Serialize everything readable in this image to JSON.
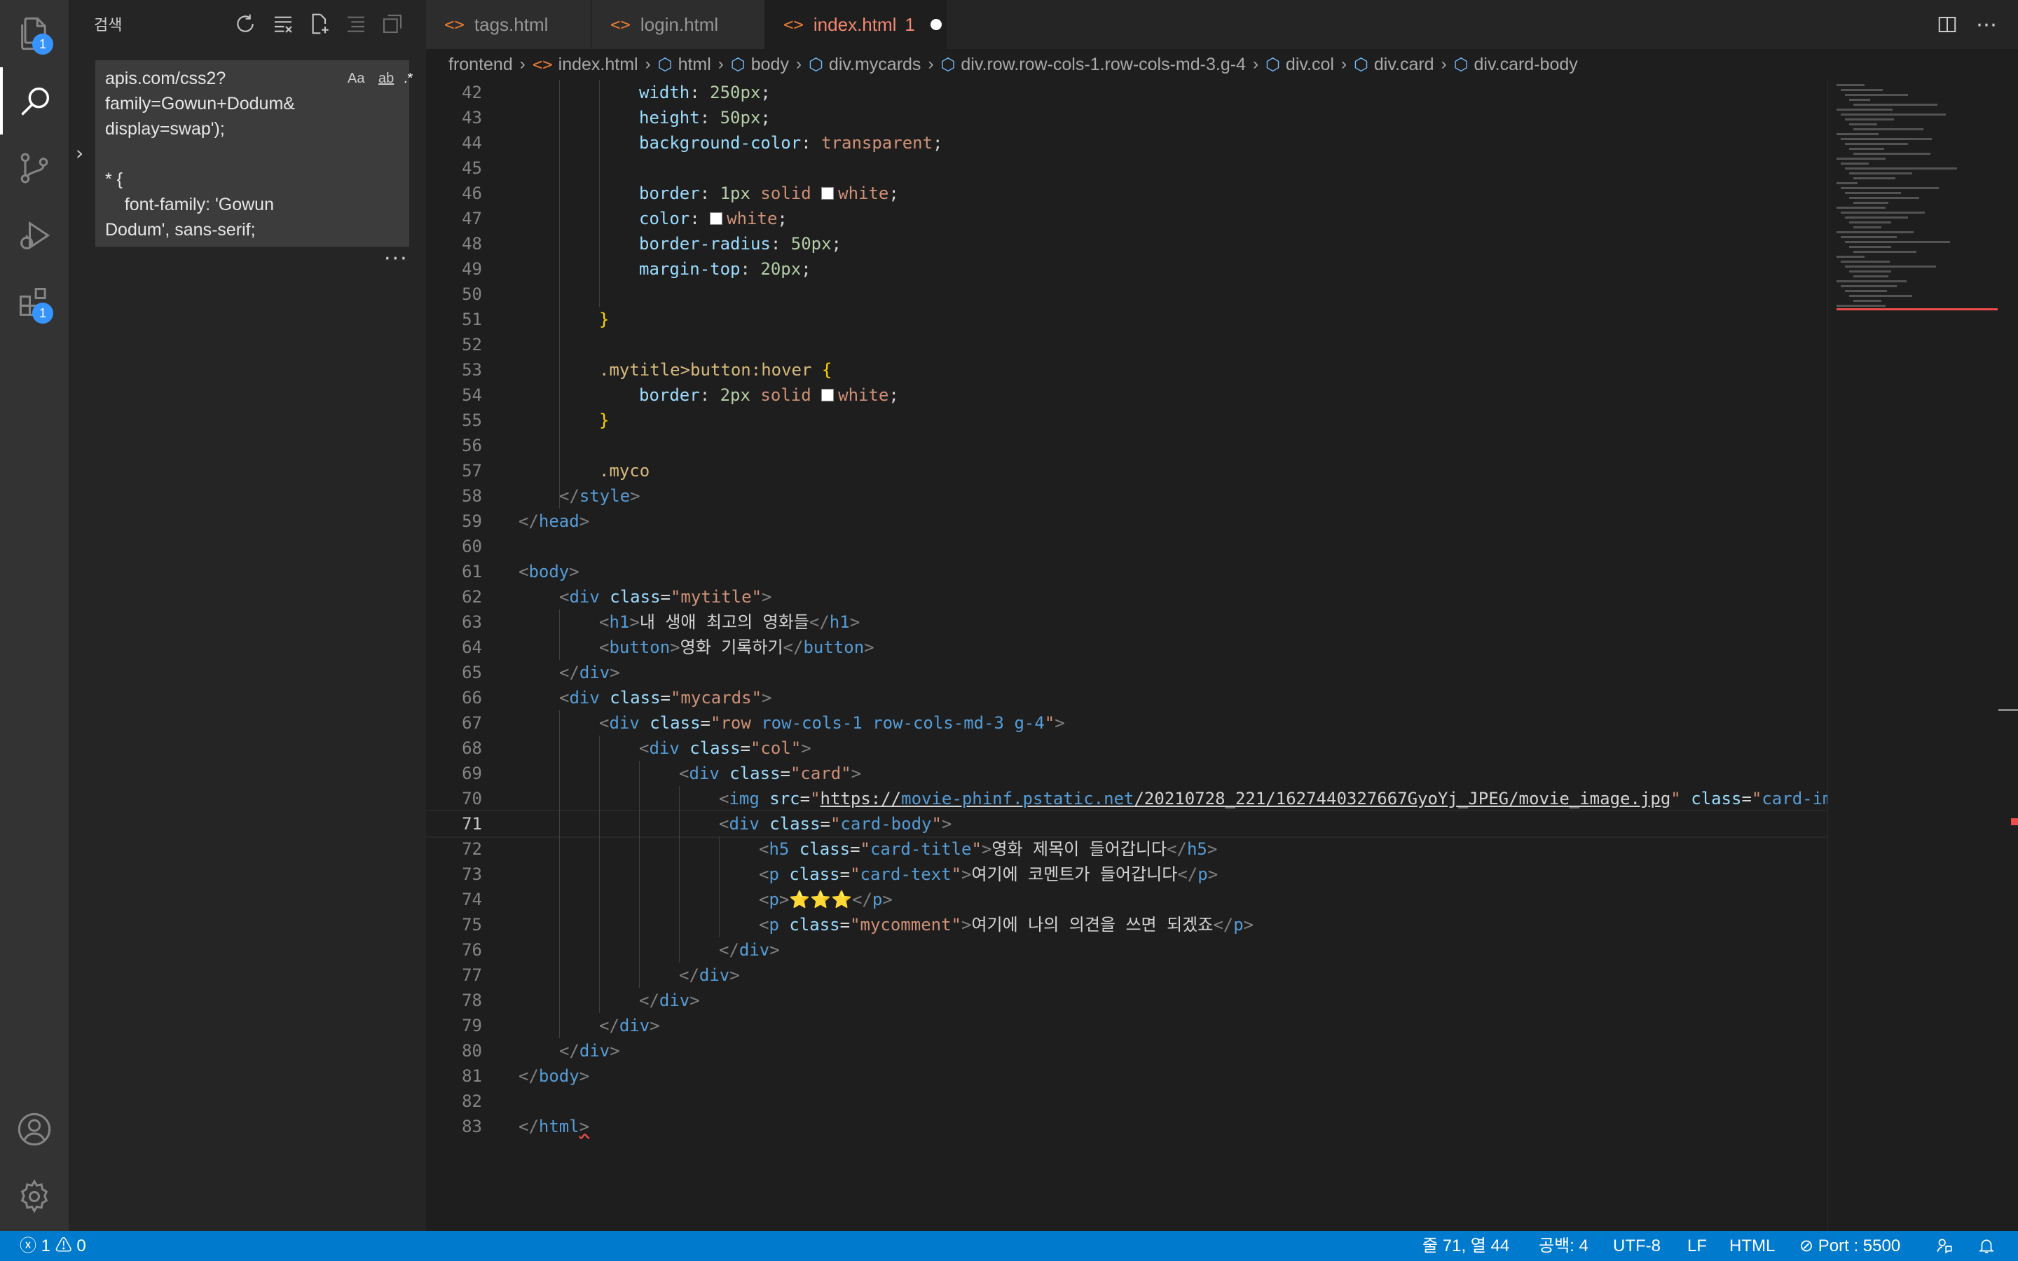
{
  "activity_bar": {
    "explorer_badge": "1",
    "extensions_badge": "1"
  },
  "sidebar": {
    "title": "검색",
    "hover_popup_text": "apis.com/css2?\nfamily=Gowun+Dodum&\ndisplay=swap');\n\n* {\n    font-family: 'Gowun\nDodum', sans-serif;",
    "options": {
      "match_case": "Aa",
      "whole_word": "ab",
      "regex": ".*"
    },
    "more": "···"
  },
  "tabs": [
    {
      "label": "tags.html",
      "active": false
    },
    {
      "label": "login.html",
      "active": false
    },
    {
      "label": "index.html",
      "active": true,
      "problems": "1",
      "dirty": true
    }
  ],
  "breadcrumb": [
    "frontend",
    "index.html",
    "html",
    "body",
    "div.mycards",
    "div.row.row-cols-1.row-cols-md-3.g-4",
    "div.col",
    "div.card",
    "div.card-body"
  ],
  "editor": {
    "current_line": 71,
    "lines": [
      {
        "n": "42"
      },
      {
        "n": "43"
      },
      {
        "n": "44"
      },
      {
        "n": "45"
      },
      {
        "n": "46"
      },
      {
        "n": "47"
      },
      {
        "n": "48"
      },
      {
        "n": "49"
      },
      {
        "n": "50"
      },
      {
        "n": "51"
      },
      {
        "n": "52"
      },
      {
        "n": "53"
      },
      {
        "n": "54"
      },
      {
        "n": "55"
      },
      {
        "n": "56"
      },
      {
        "n": "57"
      },
      {
        "n": "58"
      },
      {
        "n": "59"
      },
      {
        "n": "60"
      },
      {
        "n": "61"
      },
      {
        "n": "62"
      },
      {
        "n": "63"
      },
      {
        "n": "64"
      },
      {
        "n": "65"
      },
      {
        "n": "66"
      },
      {
        "n": "67"
      },
      {
        "n": "68"
      },
      {
        "n": "69"
      },
      {
        "n": "70"
      },
      {
        "n": "71"
      },
      {
        "n": "72"
      },
      {
        "n": "73"
      },
      {
        "n": "74"
      },
      {
        "n": "75"
      },
      {
        "n": "76"
      },
      {
        "n": "77"
      },
      {
        "n": "78"
      },
      {
        "n": "79"
      },
      {
        "n": "80"
      },
      {
        "n": "81"
      },
      {
        "n": "82"
      },
      {
        "n": "83"
      }
    ],
    "text": {
      "l42_prop": "width",
      "l42_val": "250px",
      "l43_prop": "height",
      "l43_val": "50px",
      "l44_prop": "background-color",
      "l44_val": "transparent",
      "l46_prop": "border",
      "l46_num": "1px",
      "l46_kw": "solid",
      "l46_col": "white",
      "l47_prop": "color",
      "l47_col": "white",
      "l48_prop": "border-radius",
      "l48_val": "50px",
      "l49_prop": "margin-top",
      "l49_val": "20px",
      "l53_sel": ".mytitle>button:hover",
      "l54_prop": "border",
      "l54_num": "2px",
      "l54_kw": "solid",
      "l54_col": "white",
      "l57_sel": ".myco",
      "style_tag": "style",
      "head_tag": "head",
      "body_tag": "body",
      "div_tag": "div",
      "h1_tag": "h1",
      "button_tag": "button",
      "img_tag": "img",
      "h5_tag": "h5",
      "p_tag": "p",
      "html_tag": "html",
      "class_attr": "class",
      "src_attr": "src",
      "mytitle": "\"mytitle\"",
      "h1_text": "내 생애 최고의 영화들",
      "button_text": "영화 기록하기",
      "mycards": "\"mycards\"",
      "row_a": "\"row ",
      "row_b": "row-cols-1 row-cols-md-3 g-4",
      "row_c": "\"",
      "col": "\"col\"",
      "card": "\"card\"",
      "src_q": "\"",
      "src_proto": "https://",
      "src_host": "movie-phinf.pstatic.net",
      "src_path": "/20210728_221/1627440327667GyoYj_JPEG/movie_image.jpg",
      "card_img_a": "\"",
      "card_img_b": "card-im",
      "card_body_a": "\"",
      "card_body_b": "card-body",
      "card_body_c": "\"",
      "card_title_a": "\"",
      "card_title_b": "card-title",
      "card_title_c": "\"",
      "h5_text": "영화 제목이 들어갑니다",
      "card_text_a": "\"",
      "card_text_b": "card-text",
      "card_text_c": "\"",
      "p_text": "여기에 코멘트가 들어갑니다",
      "stars": "⭐⭐⭐",
      "mycomment": "\"mycomment\"",
      "comment_text": "여기에 나의 의견을 쓰면 되겠죠"
    }
  },
  "statusbar": {
    "errors": "1",
    "warnings": "0",
    "cursor": "줄 71, 열 44",
    "spaces": "공백: 4",
    "encoding": "UTF-8",
    "eol": "LF",
    "language": "HTML",
    "port": "Port : 5500"
  },
  "colors": {
    "accent": "#007acc",
    "modified_tab": "#f48771",
    "badge": "#3794ff",
    "error": "#f14c4c"
  }
}
